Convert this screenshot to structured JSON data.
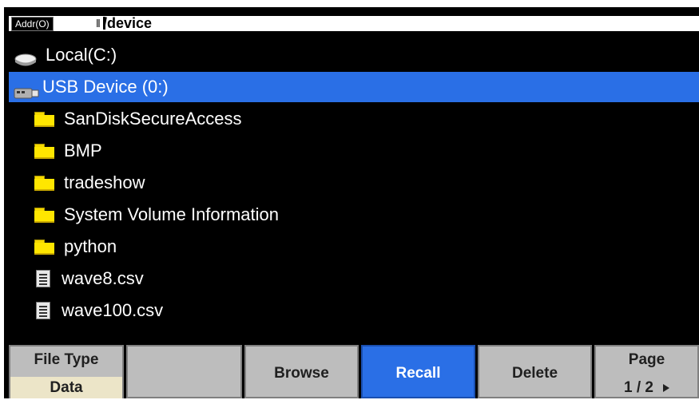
{
  "address_bar": {
    "label": "Addr(O)",
    "path": "/device"
  },
  "file_list": {
    "items": [
      {
        "name": "Local(C:)",
        "type": "drive",
        "icon": "hard-drive-icon",
        "selected": false
      },
      {
        "name": "USB Device (0:)",
        "type": "usb-drive",
        "icon": "usb-drive-icon",
        "selected": true
      },
      {
        "name": "SanDiskSecureAccess",
        "type": "folder",
        "icon": "folder-icon",
        "selected": false
      },
      {
        "name": "BMP",
        "type": "folder",
        "icon": "folder-icon",
        "selected": false
      },
      {
        "name": "tradeshow",
        "type": "folder",
        "icon": "folder-icon",
        "selected": false
      },
      {
        "name": "System Volume Information",
        "type": "folder",
        "icon": "folder-icon",
        "selected": false
      },
      {
        "name": "python",
        "type": "folder",
        "icon": "folder-icon",
        "selected": false
      },
      {
        "name": "wave8.csv",
        "type": "file",
        "icon": "file-icon",
        "selected": false
      },
      {
        "name": "wave100.csv",
        "type": "file",
        "icon": "file-icon",
        "selected": false
      }
    ]
  },
  "softkeys": {
    "file_type_label": "File Type",
    "file_type_value": "Data",
    "blank": "",
    "browse": "Browse",
    "recall": "Recall",
    "delete": "Delete",
    "page_label": "Page",
    "page_value": "1 / 2",
    "page_arrow_icon": "arrow-right-icon"
  },
  "colors": {
    "background": "#000000",
    "selection": "#2a6fe6",
    "softkey_gray": "#bdbdbd",
    "softkey_active": "#2a6fe6",
    "folder": "#ffe600",
    "text": "#ffffff"
  }
}
